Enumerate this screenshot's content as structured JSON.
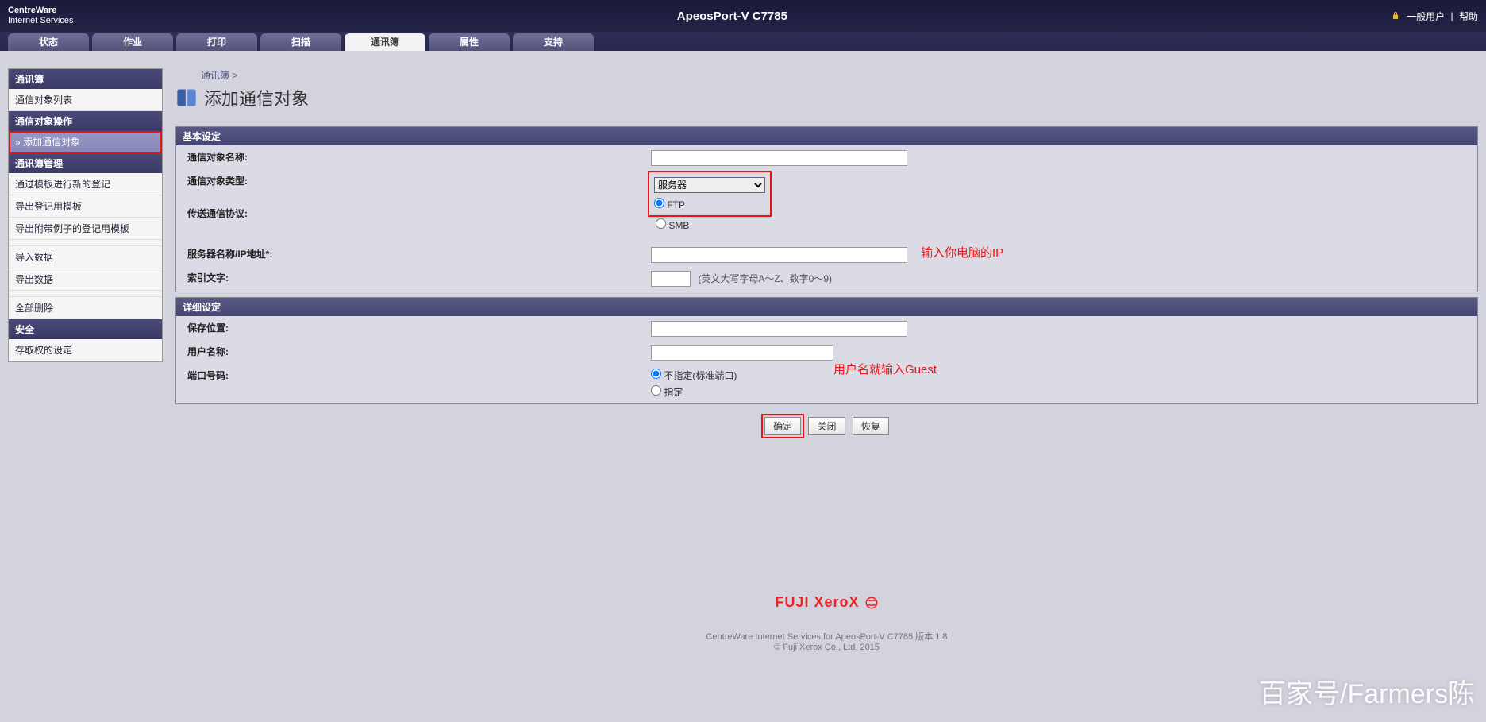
{
  "header": {
    "brand_top": "CentreWare",
    "brand_bottom": "Internet Services",
    "model": "ApeosPort-V C7785",
    "user_label": "一般用户",
    "help_label": "帮助"
  },
  "tabs": [
    {
      "label": "状态"
    },
    {
      "label": "作业"
    },
    {
      "label": "打印"
    },
    {
      "label": "扫描"
    },
    {
      "label": "通讯簿",
      "active": true
    },
    {
      "label": "属性"
    },
    {
      "label": "支持"
    }
  ],
  "sidebar": {
    "sec1": {
      "title": "通讯簿",
      "items": [
        {
          "label": "通信对象列表"
        }
      ]
    },
    "sec2": {
      "title": "通信对象操作",
      "items": [
        {
          "label": "» 添加通信对象",
          "active": true
        }
      ]
    },
    "sec3": {
      "title": "通讯簿管理",
      "items": [
        {
          "label": "通过模板进行新的登记"
        },
        {
          "label": "导出登记用模板"
        },
        {
          "label": "导出附带例子的登记用模板"
        },
        {
          "label": ""
        },
        {
          "label": "导入数据"
        },
        {
          "label": "导出数据"
        },
        {
          "label": ""
        },
        {
          "label": "全部删除"
        }
      ]
    },
    "sec4": {
      "title": "安全",
      "items": [
        {
          "label": "存取权的设定"
        }
      ]
    }
  },
  "breadcrumb": "通讯簿 >",
  "page_title": "添加通信对象",
  "basic": {
    "title": "基本设定",
    "name_label": "通信对象名称:",
    "type_label": "通信对象类型:",
    "type_value": "服务器",
    "proto_label": "传送通信协议:",
    "proto_ftp": "FTP",
    "proto_smb": "SMB",
    "server_label": "服务器名称/IP地址*:",
    "index_label": "索引文字:",
    "index_hint": "(英文大写字母A～Z、数字0～9)"
  },
  "detail": {
    "title": "详细设定",
    "save_label": "保存位置:",
    "user_label": "用户名称:",
    "port_label": "端口号码:",
    "port_opt1": "不指定(标准端口)",
    "port_opt2": "指定"
  },
  "annotations": {
    "ip_hint": "输入你电脑的IP",
    "user_hint": "用户名就输入Guest"
  },
  "buttons": {
    "ok": "确定",
    "close": "关闭",
    "restore": "恢复"
  },
  "footer": {
    "logo": "FUJI XeroX",
    "line1": "CentreWare Internet Services for ApeosPort-V C7785 版本 1.8",
    "line2": "© Fuji Xerox Co., Ltd. 2015"
  },
  "watermark": "百家号/Farmers陈"
}
